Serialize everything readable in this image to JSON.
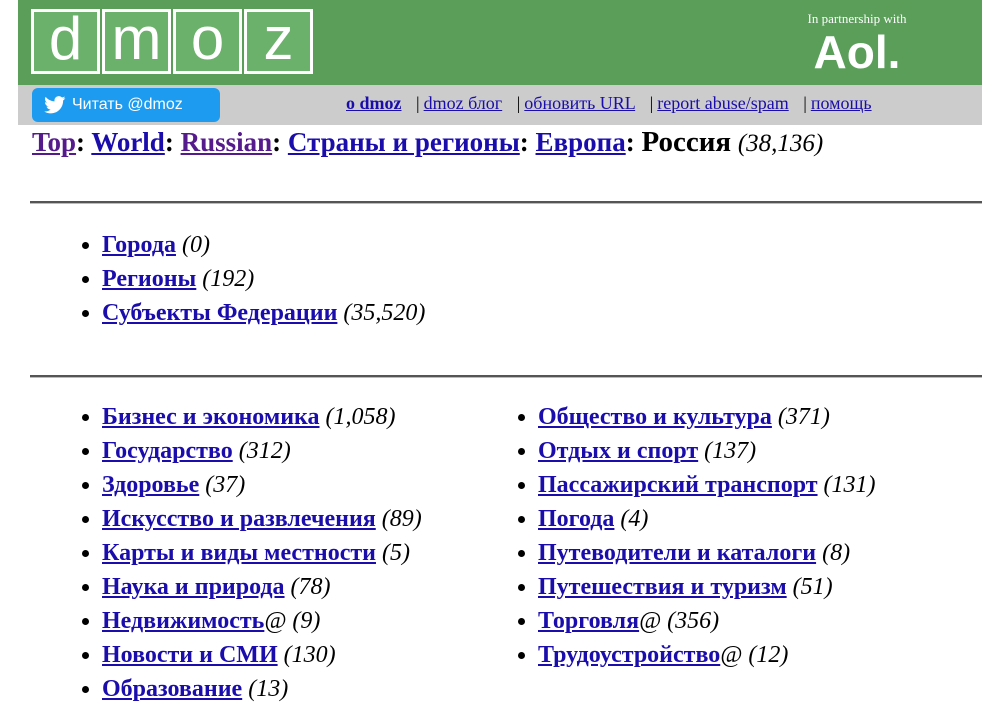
{
  "header": {
    "logo_letters": [
      "d",
      "m",
      "o",
      "z"
    ],
    "partner_text": "In partnership with",
    "partner_brand": "Aol."
  },
  "toolbar": {
    "twitter_label": "Читать @dmoz",
    "links": [
      {
        "label": "o dmoz",
        "bold": true
      },
      {
        "label": "dmoz блог"
      },
      {
        "label": "обновить URL"
      },
      {
        "label": "report abuse/spam"
      },
      {
        "label": "помощь"
      }
    ],
    "separator": "|"
  },
  "breadcrumb": {
    "items": [
      {
        "label": "Top",
        "visited": true
      },
      {
        "label": "World",
        "visited": false
      },
      {
        "label": "Russian",
        "visited": true
      },
      {
        "label": "Страны и регионы",
        "visited": false
      },
      {
        "label": "Европа",
        "visited": false
      }
    ],
    "current": "Россия",
    "count": "(38,136)"
  },
  "subcategories": [
    {
      "label": "Города",
      "count": "(0)"
    },
    {
      "label": "Регионы",
      "count": "(192)"
    },
    {
      "label": "Субъекты Федерации",
      "count": "(35,520)"
    }
  ],
  "topics_left": [
    {
      "label": "Бизнес и экономика",
      "count": "(1,058)"
    },
    {
      "label": "Государство",
      "count": "(312)"
    },
    {
      "label": "Здоровье",
      "count": "(37)"
    },
    {
      "label": "Искусство и развлечения",
      "count": "(89)"
    },
    {
      "label": "Карты и виды местности",
      "count": "(5)"
    },
    {
      "label": "Наука и природа",
      "count": "(78)"
    },
    {
      "label": "Недвижимость",
      "suffix": "@",
      "count": "(9)"
    },
    {
      "label": "Новости и СМИ",
      "count": "(130)"
    },
    {
      "label": "Образование",
      "count": "(13)"
    }
  ],
  "topics_right": [
    {
      "label": "Общество и культура",
      "count": "(371)"
    },
    {
      "label": "Отдых и спорт",
      "count": "(137)"
    },
    {
      "label": "Пассажирский транспорт",
      "count": "(131)"
    },
    {
      "label": "Погода",
      "count": "(4)"
    },
    {
      "label": "Путеводители и каталоги",
      "count": "(8)"
    },
    {
      "label": "Путешествия и туризм",
      "count": "(51)"
    },
    {
      "label": "Торговля",
      "suffix": "@",
      "count": "(356)"
    },
    {
      "label": "Трудоустройство",
      "suffix": "@",
      "count": "(12)"
    }
  ]
}
